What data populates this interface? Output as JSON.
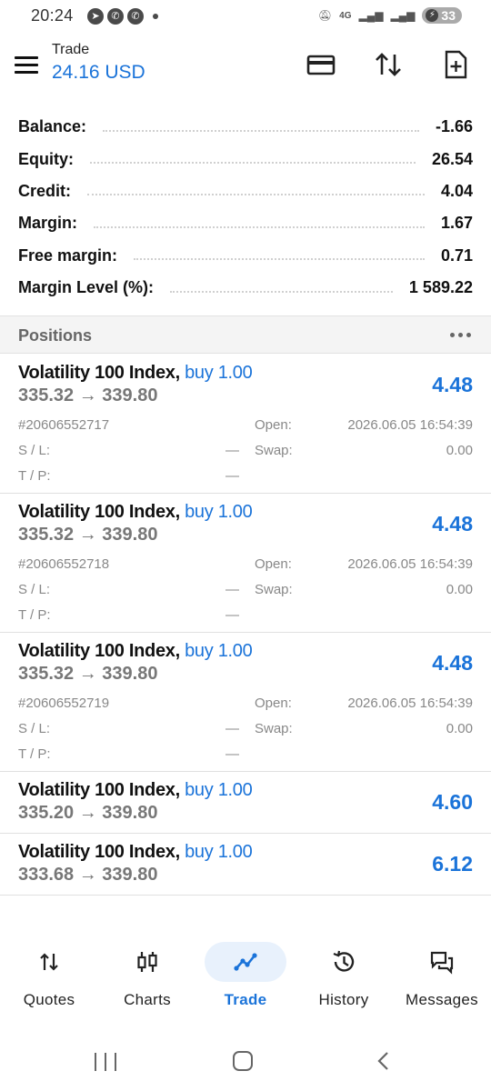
{
  "status_bar": {
    "time": "20:24",
    "network": "4G",
    "battery": "33"
  },
  "header": {
    "title": "Trade",
    "balance": "24.16 USD"
  },
  "summary": [
    {
      "label": "Balance:",
      "value": "-1.66"
    },
    {
      "label": "Equity:",
      "value": "26.54"
    },
    {
      "label": "Credit:",
      "value": "4.04"
    },
    {
      "label": "Margin:",
      "value": "1.67"
    },
    {
      "label": "Free margin:",
      "value": "0.71"
    },
    {
      "label": "Margin Level (%):",
      "value": "1 589.22"
    }
  ],
  "positions_header": "Positions",
  "positions": [
    {
      "symbol": "Volatility 100 Index,",
      "type": "buy 1.00",
      "prices": "335.32 → 339.80",
      "profit": "4.48",
      "ticket": "#20606552717",
      "open_label": "Open:",
      "open_time": "2026.06.05 16:54:39",
      "sl_label": "S / L:",
      "sl": "—",
      "swap_label": "Swap:",
      "swap": "0.00",
      "tp_label": "T / P:",
      "tp": "—"
    },
    {
      "symbol": "Volatility 100 Index,",
      "type": "buy 1.00",
      "prices": "335.32 → 339.80",
      "profit": "4.48",
      "ticket": "#20606552718",
      "open_label": "Open:",
      "open_time": "2026.06.05 16:54:39",
      "sl_label": "S / L:",
      "sl": "—",
      "swap_label": "Swap:",
      "swap": "0.00",
      "tp_label": "T / P:",
      "tp": "—"
    },
    {
      "symbol": "Volatility 100 Index,",
      "type": "buy 1.00",
      "prices": "335.32 → 339.80",
      "profit": "4.48",
      "ticket": "#20606552719",
      "open_label": "Open:",
      "open_time": "2026.06.05 16:54:39",
      "sl_label": "S / L:",
      "sl": "—",
      "swap_label": "Swap:",
      "swap": "0.00",
      "tp_label": "T / P:",
      "tp": "—"
    },
    {
      "symbol": "Volatility 100 Index,",
      "type": "buy 1.00",
      "prices": "335.20 → 339.80",
      "profit": "4.60"
    },
    {
      "symbol": "Volatility 100 Index,",
      "type": "buy 1.00",
      "prices": "333.68 → 339.80",
      "profit": "6.12"
    }
  ],
  "bottom_nav": [
    {
      "label": "Quotes",
      "icon": "quotes-icon"
    },
    {
      "label": "Charts",
      "icon": "charts-icon"
    },
    {
      "label": "Trade",
      "icon": "trade-icon",
      "active": true
    },
    {
      "label": "History",
      "icon": "history-icon"
    },
    {
      "label": "Messages",
      "icon": "messages-icon"
    }
  ],
  "colors": {
    "accent": "#1a73d9",
    "active_nav_bg": "#e8f1fc",
    "section_bg": "#f4f4f4"
  }
}
